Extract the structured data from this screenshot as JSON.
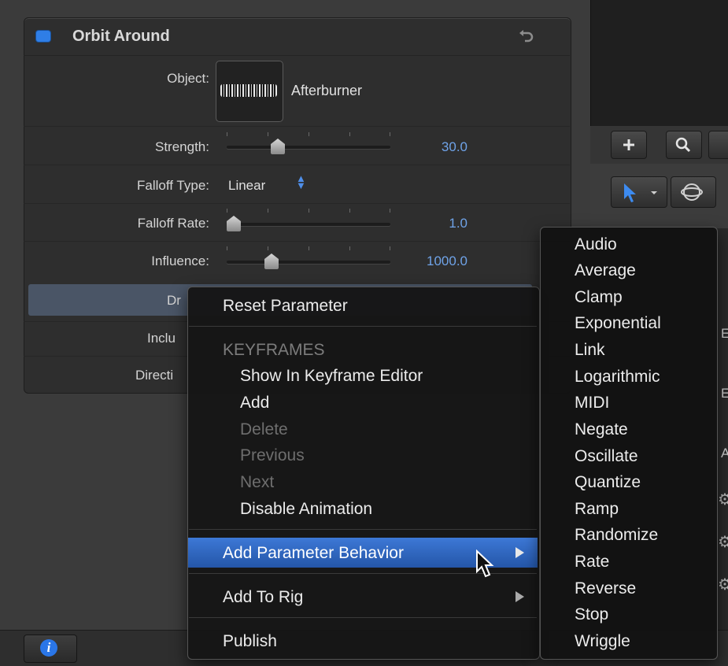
{
  "behavior": {
    "title": "Orbit Around",
    "enabled": true,
    "accent_color": "#2f7ee6"
  },
  "params": {
    "object": {
      "label": "Object:",
      "value": "Afterburner"
    },
    "strength": {
      "label": "Strength:",
      "value": "30.0",
      "level": 0.3
    },
    "falloff_type": {
      "label": "Falloff Type:",
      "value": "Linear"
    },
    "falloff_rate": {
      "label": "Falloff Rate:",
      "value": "1.0",
      "level": 0.01
    },
    "influence": {
      "label": "Influence:",
      "value": "1000.0",
      "level": 0.28
    },
    "drag_partial": "Dr",
    "include_partial": "Inclu",
    "direction_partial": "Directi"
  },
  "context_menu": {
    "reset": "Reset Parameter",
    "keyframes_header": "KEYFRAMES",
    "show_in_editor": "Show In Keyframe Editor",
    "add": "Add",
    "delete": "Delete",
    "previous": "Previous",
    "next": "Next",
    "disable_animation": "Disable Animation",
    "add_parameter_behavior": "Add Parameter Behavior",
    "add_to_rig": "Add To Rig",
    "publish": "Publish"
  },
  "submenu": {
    "items": [
      "Audio",
      "Average",
      "Clamp",
      "Exponential",
      "Link",
      "Logarithmic",
      "MIDI",
      "Negate",
      "Oscillate",
      "Quantize",
      "Ramp",
      "Randomize",
      "Rate",
      "Reverse",
      "Stop",
      "Wriggle"
    ]
  },
  "right_list_partial": [
    "E",
    "E",
    "A"
  ],
  "info_button": "i",
  "icons": [
    "undo-icon",
    "plus-icon",
    "magnifier-icon",
    "select-arrow-icon",
    "orbit-3d-icon",
    "info-icon",
    "submenu-arrow-icon",
    "mouse-cursor-icon",
    "gear-icon"
  ]
}
